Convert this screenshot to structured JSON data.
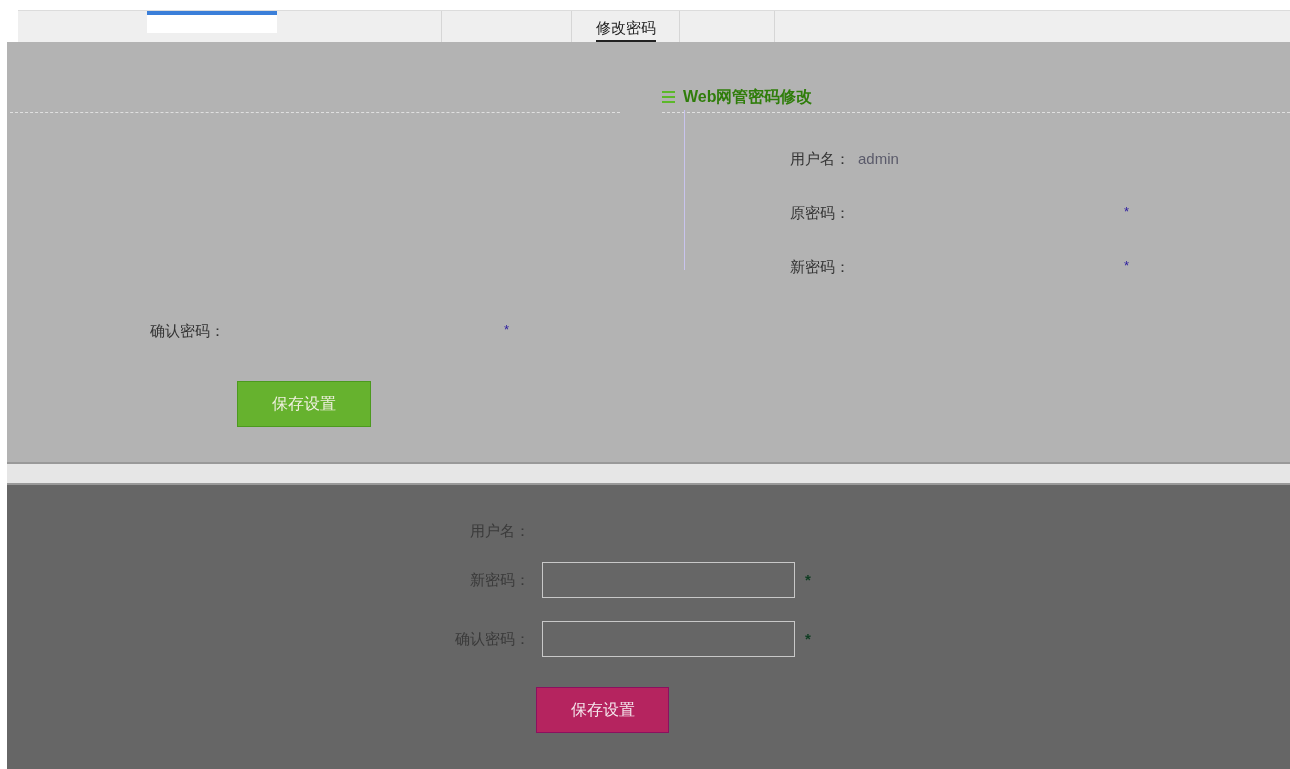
{
  "tabs": [
    {
      "label": "修改密码",
      "selected": true
    }
  ],
  "upper_form": {
    "title": "Web网管密码修改",
    "username_label": "用户名：",
    "username": "admin",
    "fields": [
      {
        "label": "原密码：",
        "required": "*"
      },
      {
        "label": "新密码：",
        "required": "*"
      },
      {
        "label": "确认密码：",
        "required": "*"
      }
    ],
    "button": "保存设置"
  },
  "lower_form": {
    "username_label": "用户名：",
    "fields": [
      {
        "label": "新密码：",
        "required": "*"
      },
      {
        "label": "确认密码：",
        "required": "*"
      }
    ],
    "button": "保存设置"
  }
}
